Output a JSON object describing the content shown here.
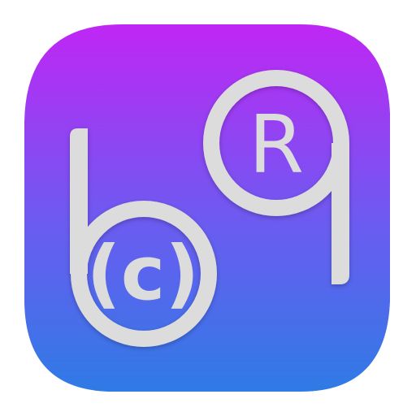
{
  "app_icon": {
    "copyright_mark": "(c)",
    "registered_mark": "R",
    "colors": {
      "gradient_top": "#c026f5",
      "gradient_bottom": "#2f7be6",
      "glyph": "#dcdcdc",
      "background": "#ffffff"
    }
  }
}
